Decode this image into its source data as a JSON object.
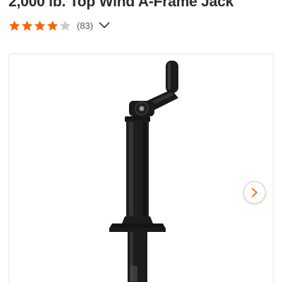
{
  "product": {
    "title": "2,000 lb. Top Wind A-Frame Jack"
  },
  "rating": {
    "value": 4,
    "max": 5,
    "review_count": "(83)",
    "star_color": "#f96302",
    "empty_star_color": "#cccccc"
  },
  "icons": {
    "expand": "chevron-down-icon",
    "next": "chevron-right-icon"
  },
  "colors": {
    "accent": "#f96302",
    "text": "#2b2b2b"
  }
}
